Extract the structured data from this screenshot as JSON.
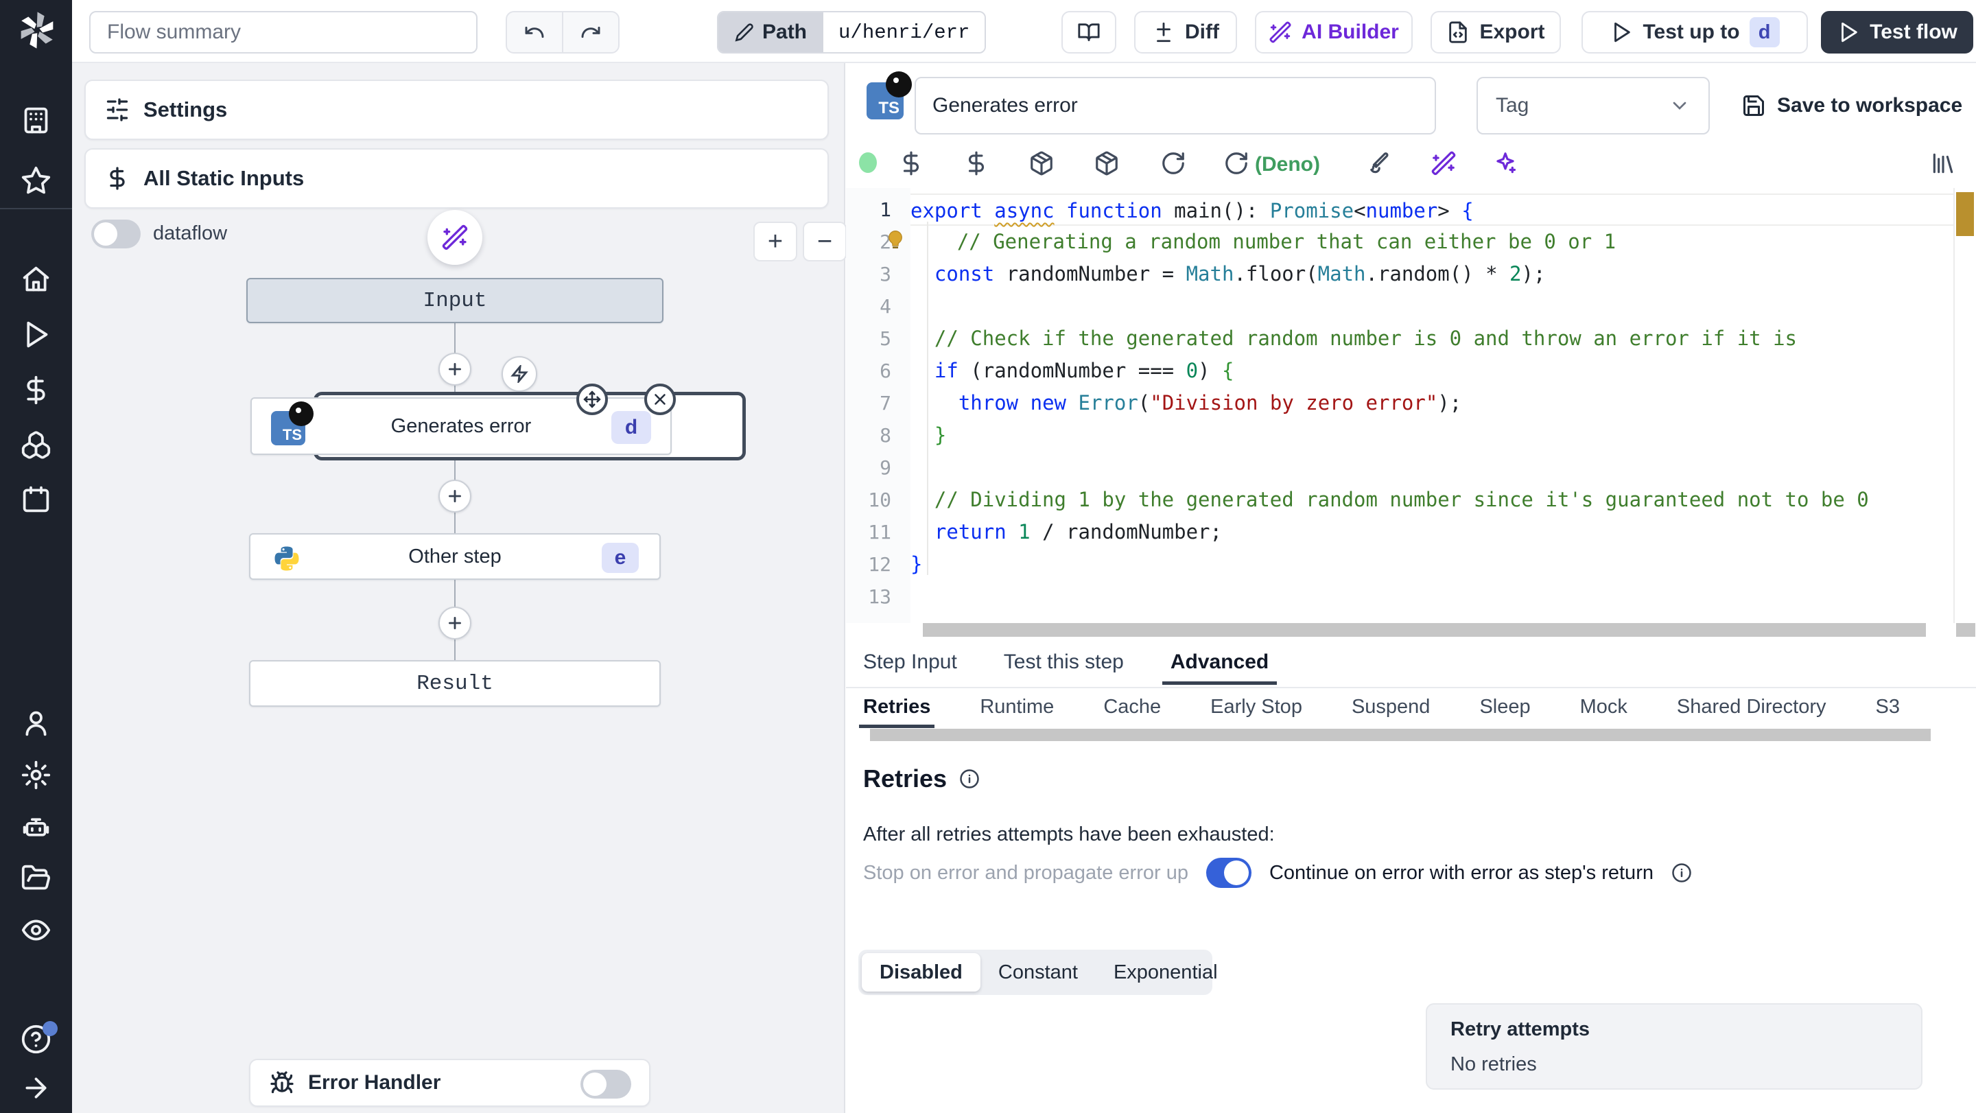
{
  "topbar": {
    "flow_summary_placeholder": "Flow summary",
    "path_label": "Path",
    "path_value": "u/henri/err",
    "diff_label": "Diff",
    "ai_builder_label": "AI Builder",
    "export_label": "Export",
    "test_up_to_label": "Test up to",
    "test_up_to_badge": "d",
    "test_flow_label": "Test flow"
  },
  "flow": {
    "settings_label": "Settings",
    "static_inputs_label": "All Static Inputs",
    "dataflow_label": "dataflow",
    "zoom_in_label": "+",
    "zoom_out_label": "−",
    "nodes": {
      "input_label": "Input",
      "step1_label": "Generates error",
      "step1_badge": "d",
      "step2_label": "Other step",
      "step2_badge": "e",
      "result_label": "Result"
    },
    "error_handler_label": "Error Handler"
  },
  "panel": {
    "ts_badge": "TS",
    "step_name": "Generates error",
    "tag_placeholder": "Tag",
    "save_label": "Save to workspace",
    "runtime_label": "(Deno)",
    "tabs": [
      {
        "label": "Step Input",
        "active": false
      },
      {
        "label": "Test this step",
        "active": false
      },
      {
        "label": "Advanced",
        "active": true
      }
    ],
    "subtabs": [
      {
        "label": "Retries",
        "active": true
      },
      {
        "label": "Runtime",
        "active": false
      },
      {
        "label": "Cache",
        "active": false
      },
      {
        "label": "Early Stop",
        "active": false
      },
      {
        "label": "Suspend",
        "active": false
      },
      {
        "label": "Sleep",
        "active": false
      },
      {
        "label": "Mock",
        "active": false
      },
      {
        "label": "Shared Directory",
        "active": false
      },
      {
        "label": "S3",
        "active": false
      }
    ],
    "retries": {
      "title": "Retries",
      "exhausted_text": "After all retries attempts have been exhausted:",
      "stop_label": "Stop on error and propagate error up",
      "continue_label": "Continue on error with error as step's return",
      "modes": [
        {
          "label": "Disabled",
          "active": true
        },
        {
          "label": "Constant",
          "active": false
        },
        {
          "label": "Exponential",
          "active": false
        }
      ],
      "retry_attempts_label": "Retry attempts",
      "retry_attempts_value": "No retries"
    }
  },
  "editor": {
    "lines": [
      {
        "n": 1,
        "current": true,
        "tokens": [
          [
            "kw",
            "export"
          ],
          [
            "pl",
            " "
          ],
          [
            "kww",
            "async"
          ],
          [
            "pl",
            " "
          ],
          [
            "kw",
            "function"
          ],
          [
            "pl",
            " main(): "
          ],
          [
            "ty",
            "Promise"
          ],
          [
            "pl",
            "<"
          ],
          [
            "kw",
            "number"
          ],
          [
            "pl",
            "> "
          ],
          [
            "b1",
            "{"
          ]
        ]
      },
      {
        "n": 2,
        "bulb": true,
        "tokens": [
          [
            "pl",
            "  "
          ],
          [
            "com",
            "// Generating a random number that can either be 0 or 1"
          ]
        ]
      },
      {
        "n": 3,
        "tokens": [
          [
            "pl",
            "  "
          ],
          [
            "kw",
            "const"
          ],
          [
            "pl",
            " randomNumber = "
          ],
          [
            "ty",
            "Math"
          ],
          [
            "pl",
            ".floor("
          ],
          [
            "ty",
            "Math"
          ],
          [
            "pl",
            ".random() * "
          ],
          [
            "num",
            "2"
          ],
          [
            "pl",
            ");"
          ]
        ]
      },
      {
        "n": 4,
        "tokens": []
      },
      {
        "n": 5,
        "tokens": [
          [
            "pl",
            "  "
          ],
          [
            "com",
            "// Check if the generated random number is 0 and throw an error if it is"
          ]
        ]
      },
      {
        "n": 6,
        "tokens": [
          [
            "pl",
            "  "
          ],
          [
            "kw",
            "if"
          ],
          [
            "pl",
            " (randomNumber === "
          ],
          [
            "num",
            "0"
          ],
          [
            "pl",
            ") "
          ],
          [
            "b2",
            "{"
          ]
        ]
      },
      {
        "n": 7,
        "tokens": [
          [
            "pl",
            "    "
          ],
          [
            "kw",
            "throw"
          ],
          [
            "pl",
            " "
          ],
          [
            "kw",
            "new"
          ],
          [
            "pl",
            " "
          ],
          [
            "ty",
            "Error"
          ],
          [
            "pl",
            "("
          ],
          [
            "str",
            "\"Division by zero error\""
          ],
          [
            "pl",
            ");"
          ]
        ]
      },
      {
        "n": 8,
        "tokens": [
          [
            "pl",
            "  "
          ],
          [
            "b2",
            "}"
          ]
        ]
      },
      {
        "n": 9,
        "tokens": []
      },
      {
        "n": 10,
        "tokens": [
          [
            "pl",
            "  "
          ],
          [
            "com",
            "// Dividing 1 by the generated random number since it's guaranteed not to be 0"
          ]
        ]
      },
      {
        "n": 11,
        "tokens": [
          [
            "pl",
            "  "
          ],
          [
            "kw",
            "return"
          ],
          [
            "pl",
            " "
          ],
          [
            "num",
            "1"
          ],
          [
            "pl",
            " / randomNumber;"
          ]
        ]
      },
      {
        "n": 12,
        "tokens": [
          [
            "b1",
            "}"
          ]
        ]
      },
      {
        "n": 13,
        "tokens": []
      }
    ]
  },
  "colors": {
    "accent_purple": "#6d28d9",
    "toggle_blue": "#3561d9",
    "status_green_dot": "#8ce3a6",
    "deno_green": "#3f9d5f",
    "warning_marker": "#b9902e",
    "dark_button": "#2e3644",
    "sidebar_bg": "#1d222c"
  }
}
